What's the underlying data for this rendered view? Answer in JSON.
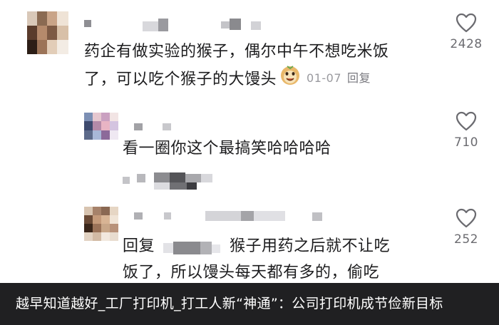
{
  "comments": [
    {
      "text_line1": "药企有做实验的猴子，偶尔中午不想吃米饭",
      "text_line2": "了，可以吃个猴子的大馒头",
      "date": "01-07",
      "reply_label": "回复",
      "likes": "2428",
      "emoji": "smiling-face-sticker-icon"
    },
    {
      "text": "看一圈你这个最搞笑哈哈哈哈",
      "likes": "710"
    },
    {
      "reply_prefix": "回复",
      "text_line1": "猴子用药之后就不让吃",
      "text_line2": "饭了，所以馒头每天都有多的，偷吃",
      "likes": "252"
    }
  ],
  "banner": {
    "title": "越早知道越好_工厂打印机_打工人新“神通”：公司打印机成节俭新目标"
  },
  "colors": {
    "banner_bg": "#0a0a0c",
    "text": "#1c1c1e",
    "meta": "#9a9a9f",
    "heart": "#6b6b70"
  }
}
